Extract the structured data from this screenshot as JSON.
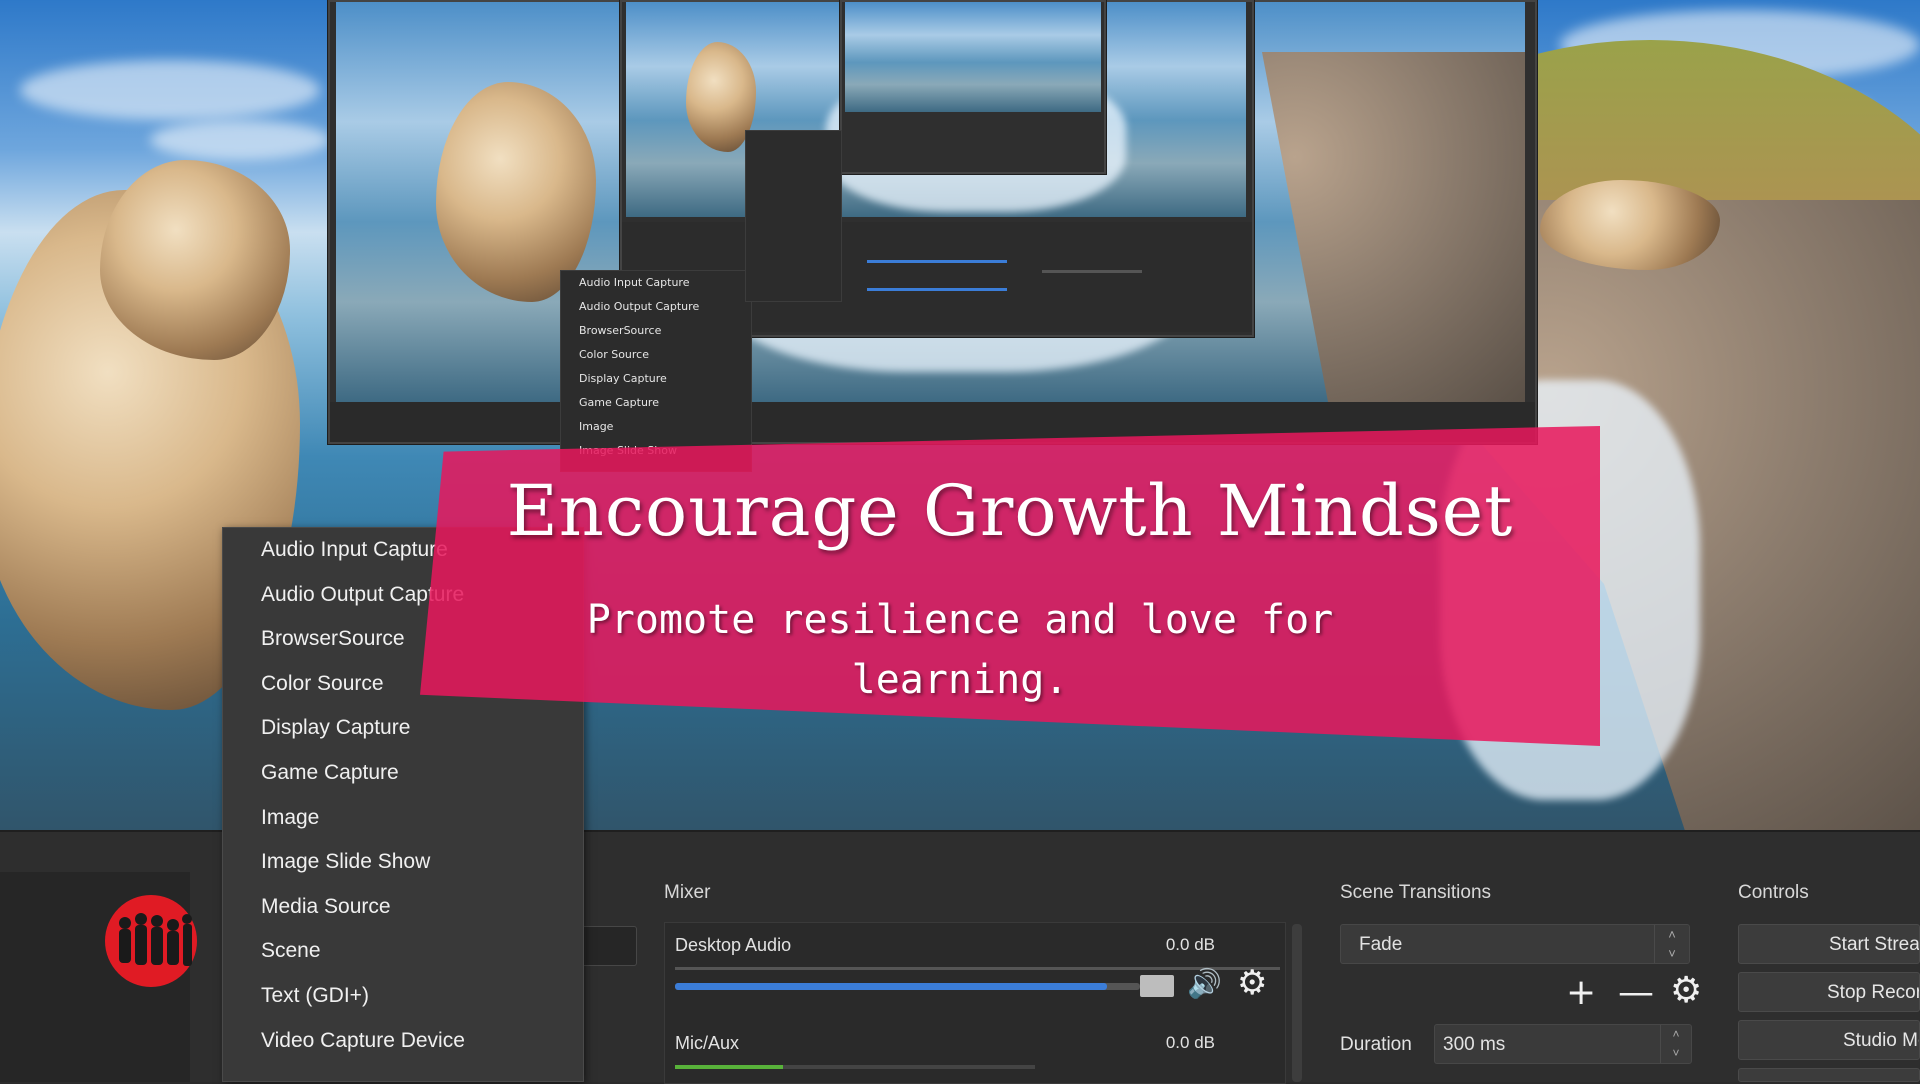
{
  "banner": {
    "title": "Encourage Growth Mindset",
    "subtitle": "Promote resilience and love for learning."
  },
  "context_menu": {
    "items": [
      "Audio Input Capture",
      "Audio Output Capture",
      "BrowserSource",
      "Color Source",
      "Display Capture",
      "Game Capture",
      "Image",
      "Image Slide Show",
      "Media Source",
      "Scene",
      "Text (GDI+)",
      "Video Capture Device"
    ]
  },
  "mixer": {
    "title": "Mixer",
    "channels": [
      {
        "name": "Desktop Audio",
        "db": "0.0 dB",
        "level": 0.93
      },
      {
        "name": "Mic/Aux",
        "db": "0.0 dB",
        "level": 0.3
      }
    ]
  },
  "transitions": {
    "title": "Scene Transitions",
    "selected": "Fade",
    "duration_label": "Duration",
    "duration_value": "300 ms"
  },
  "controls": {
    "title": "Controls",
    "buttons": [
      "Start Streaming",
      "Stop Recording",
      "Studio Mode"
    ]
  },
  "colors": {
    "accent": "#3b7dd8",
    "banner": "#e8175c",
    "panel": "#2e2e2e"
  }
}
